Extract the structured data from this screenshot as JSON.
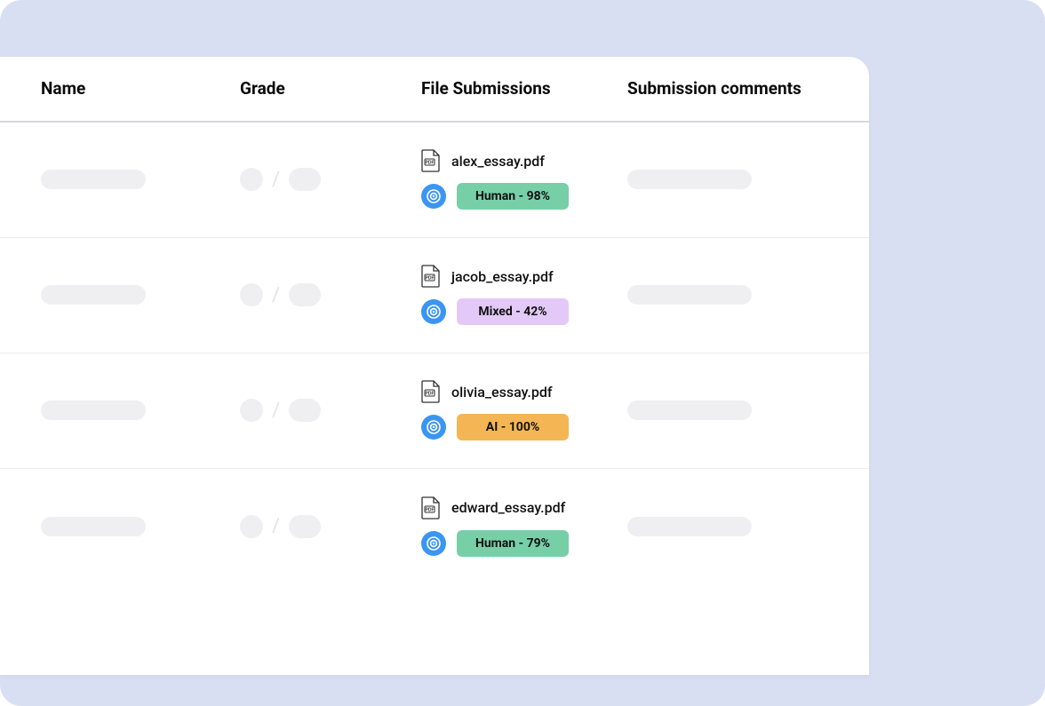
{
  "table": {
    "headers": {
      "name": "Name",
      "grade": "Grade",
      "file_submissions": "File Submissions",
      "submission_comments": "Submission comments"
    },
    "rows": [
      {
        "file": "alex_essay.pdf",
        "detection": {
          "label": "Human - 98%",
          "kind": "human"
        }
      },
      {
        "file": "jacob_essay.pdf",
        "detection": {
          "label": "Mixed - 42%",
          "kind": "mixed"
        }
      },
      {
        "file": "olivia_essay.pdf",
        "detection": {
          "label": "AI - 100%",
          "kind": "ai"
        }
      },
      {
        "file": "edward_essay.pdf",
        "detection": {
          "label": "Human - 79%",
          "kind": "human"
        }
      }
    ],
    "grade_separator": "/"
  },
  "colors": {
    "page_bg": "#d9dff2",
    "badge_human": "#77cfa8",
    "badge_mixed": "#e3c9f7",
    "badge_ai": "#f4b654",
    "logo_blue": "#3b95f2"
  }
}
